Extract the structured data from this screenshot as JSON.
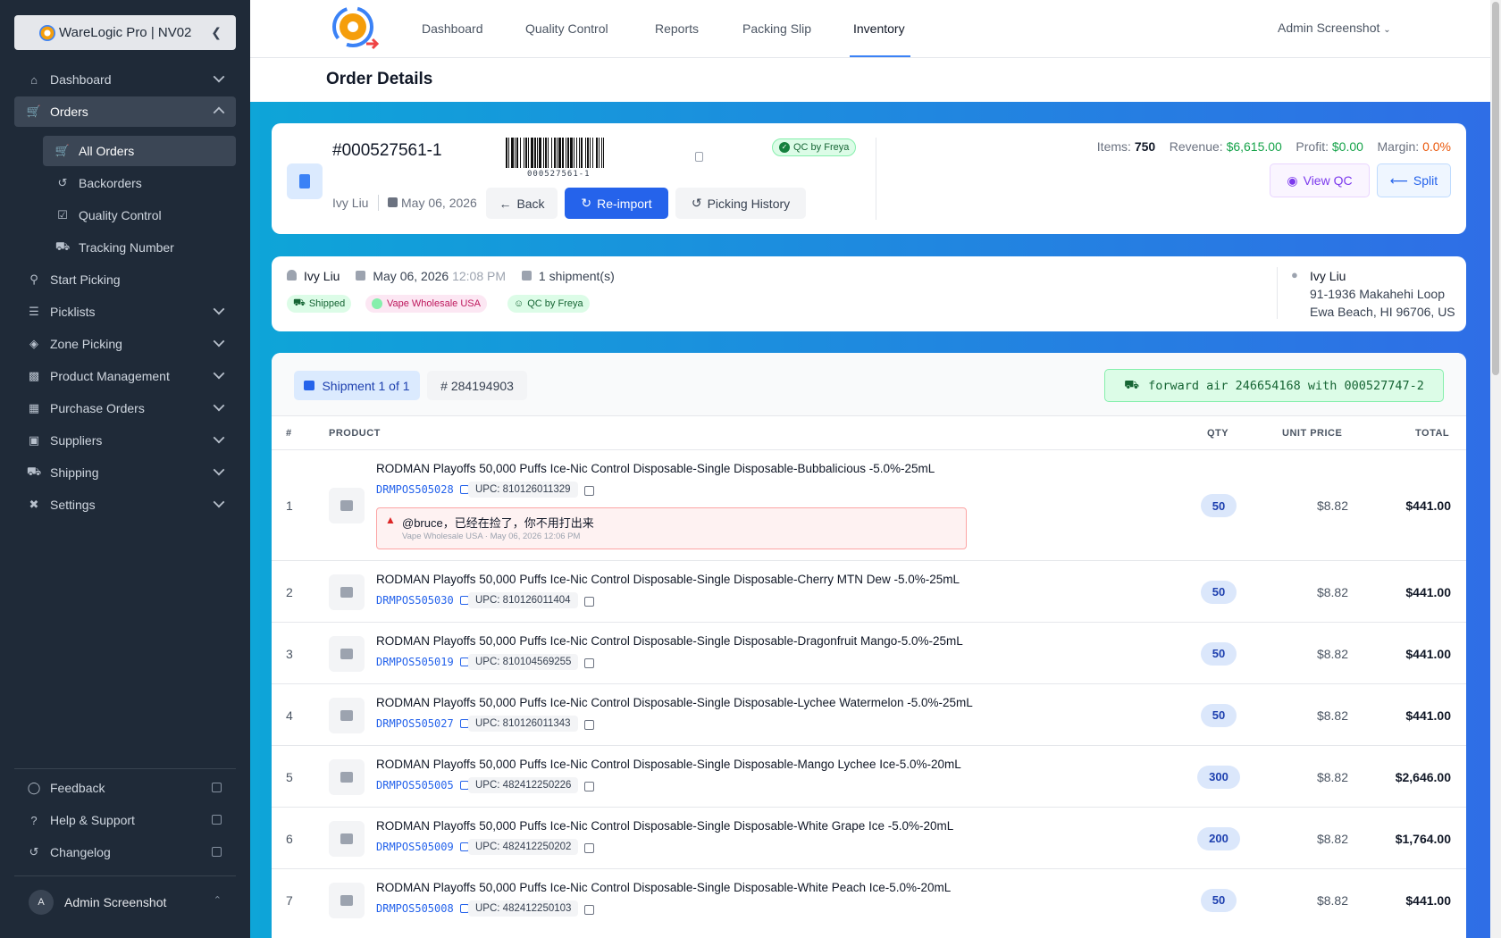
{
  "sidebar": {
    "brand": "WareLogic Pro | NV02",
    "items": [
      {
        "label": "Dashboard"
      },
      {
        "label": "Orders"
      },
      {
        "label": "All Orders"
      },
      {
        "label": "Backorders"
      },
      {
        "label": "Quality Control"
      },
      {
        "label": "Tracking Number"
      },
      {
        "label": "Start Picking"
      },
      {
        "label": "Picklists"
      },
      {
        "label": "Zone Picking"
      },
      {
        "label": "Product Management"
      },
      {
        "label": "Purchase Orders"
      },
      {
        "label": "Suppliers"
      },
      {
        "label": "Shipping"
      },
      {
        "label": "Settings"
      }
    ],
    "footer": [
      {
        "label": "Feedback"
      },
      {
        "label": "Help & Support"
      },
      {
        "label": "Changelog"
      }
    ],
    "user": {
      "initial": "A",
      "name": "Admin Screenshot"
    }
  },
  "topnav": {
    "tabs": [
      "Dashboard",
      "Quality Control",
      "Reports",
      "Packing Slip",
      "Inventory"
    ],
    "active_tab": "Inventory",
    "user_menu": "Admin Screenshot"
  },
  "page": {
    "title": "Order Details"
  },
  "order": {
    "number": "#000527561-1",
    "barcode_text": "000527561-1",
    "qc_badge": "QC by Freya",
    "customer": "Ivy Liu",
    "date": "May 06, 2026",
    "back_label": "Back",
    "reimport_label": "Re-import",
    "history_label": "Picking History",
    "stats": {
      "items_label": "Items:",
      "items": "750",
      "revenue_label": "Revenue:",
      "revenue": "$6,615.00",
      "profit_label": "Profit:",
      "profit": "$0.00",
      "margin_label": "Margin:",
      "margin": "0.0%"
    },
    "view_qc_label": "View QC",
    "split_label": "Split"
  },
  "summary": {
    "customer": "Ivy Liu",
    "date": "May 06, 2026",
    "time": "12:08 PM",
    "shipments": "1 shipment(s)",
    "badges": [
      "Shipped",
      "Vape Wholesale USA",
      "QC by Freya"
    ],
    "address": {
      "name": "Ivy Liu",
      "line1": "91-1936 Makahehi Loop",
      "line2": "Ewa Beach, HI 96706, US"
    }
  },
  "shipment": {
    "tab_label": "Shipment 1 of 1",
    "number": "284194903",
    "tracking": "forward air 246654168 with 000527747-2",
    "columns": [
      "#",
      "PRODUCT",
      "QTY",
      "UNIT PRICE",
      "TOTAL"
    ],
    "rows": [
      {
        "n": "1",
        "name": "RODMAN Playoffs 50,000 Puffs Ice-Nic Control Disposable-Single Disposable-Bubbalicious -5.0%-25mL",
        "sku": "DRMPOS505028",
        "upc": "UPC: 810126011329",
        "qty": "50",
        "price": "$8.82",
        "total": "$441.00"
      },
      {
        "n": "2",
        "name": "RODMAN Playoffs 50,000 Puffs Ice-Nic Control Disposable-Single Disposable-Cherry MTN Dew -5.0%-25mL",
        "sku": "DRMPOS505030",
        "upc": "UPC: 810126011404",
        "qty": "50",
        "price": "$8.82",
        "total": "$441.00"
      },
      {
        "n": "3",
        "name": "RODMAN Playoffs 50,000 Puffs Ice-Nic Control Disposable-Single Disposable-Dragonfruit Mango-5.0%-25mL",
        "sku": "DRMPOS505019",
        "upc": "UPC: 810104569255",
        "qty": "50",
        "price": "$8.82",
        "total": "$441.00"
      },
      {
        "n": "4",
        "name": "RODMAN Playoffs 50,000 Puffs Ice-Nic Control Disposable-Single Disposable-Lychee Watermelon -5.0%-25mL",
        "sku": "DRMPOS505027",
        "upc": "UPC: 810126011343",
        "qty": "50",
        "price": "$8.82",
        "total": "$441.00"
      },
      {
        "n": "5",
        "name": "RODMAN Playoffs 50,000 Puffs Ice-Nic Control Disposable-Single Disposable-Mango Lychee Ice-5.0%-20mL",
        "sku": "DRMPOS505005",
        "upc": "UPC: 482412250226",
        "qty": "300",
        "price": "$8.82",
        "total": "$2,646.00"
      },
      {
        "n": "6",
        "name": "RODMAN Playoffs 50,000 Puffs Ice-Nic Control Disposable-Single Disposable-White Grape Ice -5.0%-20mL",
        "sku": "DRMPOS505009",
        "upc": "UPC: 482412250202",
        "qty": "200",
        "price": "$8.82",
        "total": "$1,764.00"
      },
      {
        "n": "7",
        "name": "RODMAN Playoffs 50,000 Puffs Ice-Nic Control Disposable-Single Disposable-White Peach Ice-5.0%-20mL",
        "sku": "DRMPOS505008",
        "upc": "UPC: 482412250103",
        "qty": "50",
        "price": "$8.82",
        "total": "$441.00"
      }
    ],
    "note": {
      "text": "@bruce，已经在捡了，你不用打出来",
      "meta": "Vape Wholesale USA · May 06, 2026 12:06 PM"
    }
  },
  "colors": {
    "sidebar": "#1f2a38",
    "primary": "#2563eb",
    "revenue": "#16a34a",
    "margin": "#ea580c",
    "qc_purple": "#7c3aed"
  }
}
